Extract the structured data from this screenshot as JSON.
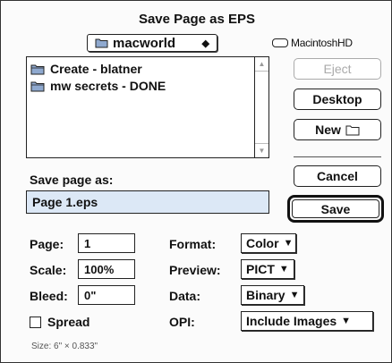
{
  "dialog": {
    "title": "Save Page as EPS",
    "folder_popup": {
      "label": "macworld",
      "arrows": "◆"
    },
    "disk_label": "MacintoshHD"
  },
  "file_list": {
    "items": [
      {
        "name": "Create - blatner"
      },
      {
        "name": "mw secrets - DONE"
      }
    ]
  },
  "buttons": {
    "eject": "Eject",
    "desktop": "Desktop",
    "new": "New",
    "cancel": "Cancel",
    "save": "Save"
  },
  "save_as": {
    "label": "Save page as:",
    "value": "Page 1.eps"
  },
  "options": {
    "page_label": "Page:",
    "page_value": "1",
    "scale_label": "Scale:",
    "scale_value": "100%",
    "bleed_label": "Bleed:",
    "bleed_value": "0\"",
    "spread_label": "Spread",
    "spread_checked": false,
    "format_label": "Format:",
    "format_value": "Color",
    "preview_label": "Preview:",
    "preview_value": "PICT",
    "data_label": "Data:",
    "data_value": "Binary",
    "opi_label": "OPI:",
    "opi_value": "Include Images"
  },
  "size_note": "Size: 6\" × 0.833\""
}
